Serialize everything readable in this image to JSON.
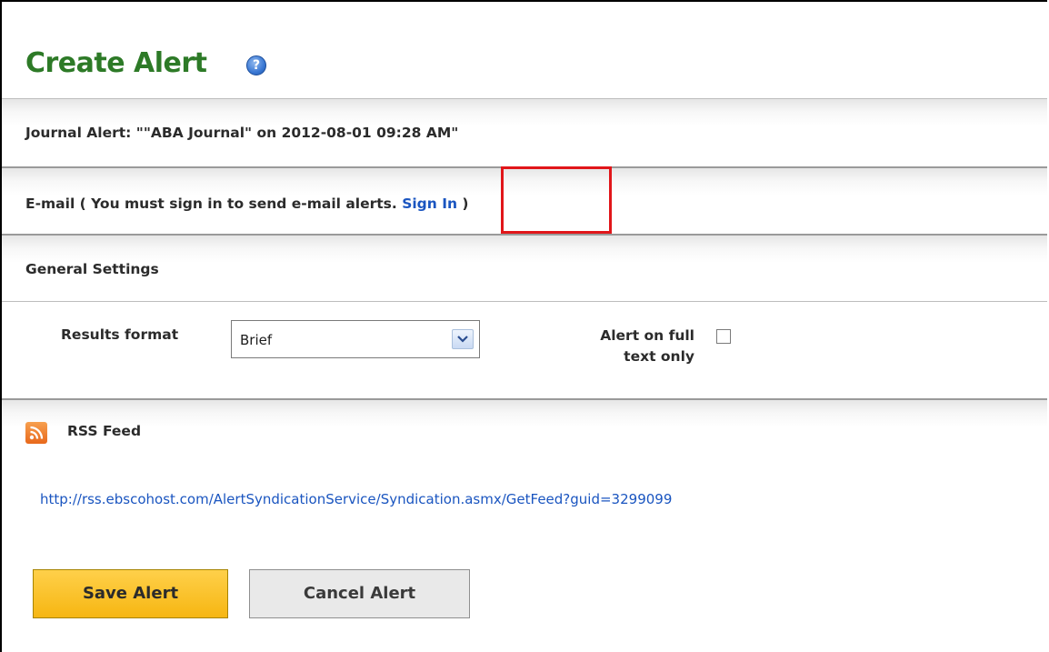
{
  "page": {
    "title": "Create Alert",
    "help_icon": "question-mark-icon",
    "help_glyph": "?"
  },
  "journal_alert": {
    "label": "Journal Alert: \"\"ABA Journal\" on 2012-08-01 09:28 AM\""
  },
  "email": {
    "prefix": "E-mail ( You must sign in to send e-mail alerts. ",
    "sign_in_link": "Sign In",
    "suffix": " )"
  },
  "general_settings": {
    "heading": "General Settings",
    "results_format_label": "Results format",
    "results_format_value": "Brief",
    "full_text_label_line1": "Alert on full",
    "full_text_label_line2": "text only",
    "full_text_checked": false
  },
  "rss": {
    "icon": "rss-feed-icon",
    "heading": "RSS Feed",
    "url": "http://rss.ebscohost.com/AlertSyndicationService/Syndication.asmx/GetFeed?guid=3299099"
  },
  "actions": {
    "save_label": "Save Alert",
    "cancel_label": "Cancel Alert"
  },
  "colors": {
    "title_green": "#2d7a27",
    "link_blue": "#1a55c0",
    "save_button": "#f6b612",
    "highlight_red": "#e1161a"
  }
}
